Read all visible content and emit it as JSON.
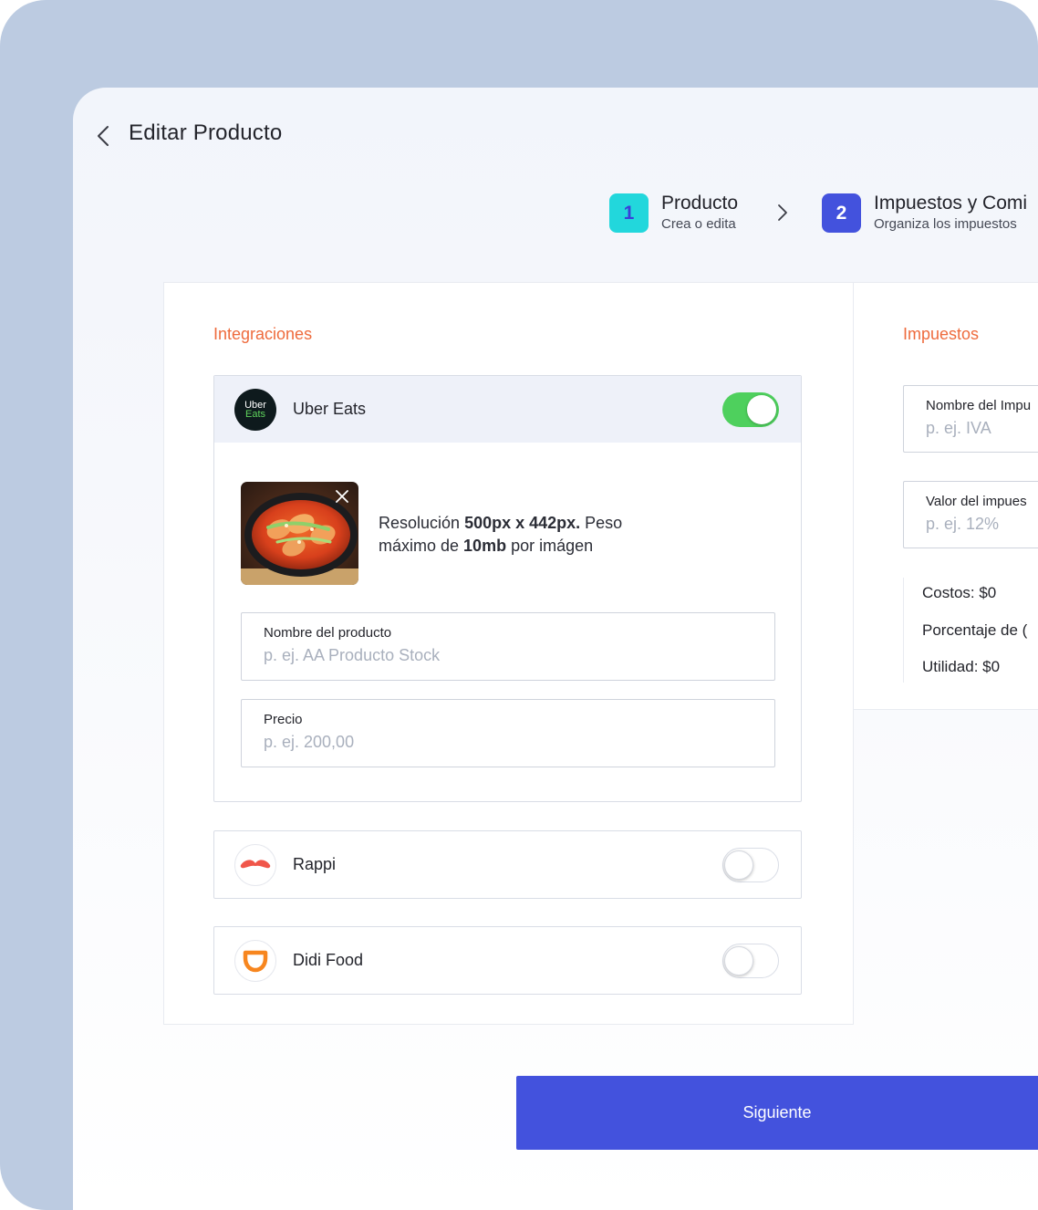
{
  "header": {
    "title": "Editar Producto",
    "back_icon": "chevron-left-icon"
  },
  "steps": [
    {
      "number": "1",
      "title": "Producto",
      "subtitle": "Crea o edita",
      "color": "#22d7dc"
    },
    {
      "number": "2",
      "title": "Impuestos y Comi",
      "subtitle": "Organiza los impuestos",
      "color": "#4352dd"
    }
  ],
  "integraciones": {
    "heading": "Integraciones",
    "uber": {
      "name": "Uber Eats",
      "logo_line1": "Uber",
      "logo_line2": "Eats",
      "enabled": true,
      "image_caption_1": "Resolución ",
      "image_caption_bold_1": "500px x 442px.",
      "image_caption_2": " Peso máximo de ",
      "image_caption_bold_2": "10mb",
      "image_caption_3": " por imágen",
      "nombre_label": "Nombre del producto",
      "nombre_placeholder": "p. ej. AA Producto Stock",
      "precio_label": "Precio",
      "precio_placeholder": "p. ej. 200,00"
    },
    "rappi": {
      "name": "Rappi",
      "enabled": false
    },
    "didi": {
      "name": "Didi Food",
      "enabled": false
    }
  },
  "impuestos": {
    "heading": "Impuestos",
    "nombre_label": "Nombre del Impu",
    "nombre_placeholder": "p. ej. IVA",
    "valor_label": "Valor del impues",
    "valor_placeholder": "p. ej. 12%",
    "costos": "Costos: $0",
    "porcentaje": "Porcentaje de (",
    "utilidad": "Utilidad: $0"
  },
  "footer": {
    "next_label": "Siguiente"
  },
  "colors": {
    "accent": "#4352dd",
    "step1": "#22d7dc",
    "section_heading": "#ee6b3d",
    "toggle_on": "#4ed05d",
    "frame": "#bccbe1"
  }
}
